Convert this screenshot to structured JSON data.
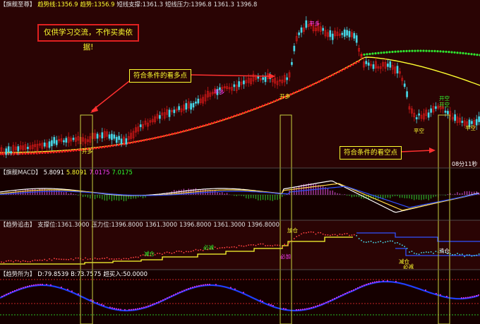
{
  "colors": {
    "bg_main": "#2a0404",
    "bg_sub": "#150000",
    "price_up": "#d01818",
    "price_down": "#46d6e6",
    "support": "#ffff30",
    "trend_red": "#ff2020",
    "trend_green": "#30e830",
    "macd_dif": "#ffffff",
    "macd_dea": "#ffd84a",
    "highlight": "#c8d040"
  },
  "pane1": {
    "title": "【旗舰至尊】",
    "trend1": "趋势线:1356.9",
    "trend2": "趋势:1356.9",
    "short_support": "短线支撑:1361.3",
    "short_resistance": "短线压力:1396.8",
    "v1": "1361.3",
    "v2": "1396.8"
  },
  "pane2": {
    "title": "【旗舰MACD】",
    "values": [
      "5.8091",
      "5.8091",
      "7.0175",
      "7.0175"
    ]
  },
  "pane3": {
    "title": "【趋势追击】",
    "support": "支撑位:1361.3000",
    "resistance": "压力位:1396.8000",
    "values": [
      "1361.3000",
      "1396.8000",
      "1361.3000",
      "1396.8000"
    ]
  },
  "pane4": {
    "title": "【趋势所为】",
    "d": "D:79.8539",
    "b": "B:73.7575",
    "buy": "超买入:50.0000"
  },
  "annotations": {
    "disclaimer": "仅供学习交流，不作买卖依据!",
    "bull_point": "符合条件的看多点",
    "bear_point": "符合条件的看空点",
    "timer": "08分11秒"
  },
  "signals": {
    "open_long_1": "开多",
    "open_long_2": "开多",
    "close_short_top": "平多",
    "close_short_mid": "平多",
    "open_short_1": "开空",
    "open_short_2": "开空",
    "close_short_1": "平空",
    "close_short_2": "平空",
    "reduce_1": "减仓",
    "reduce_2": "必减",
    "add_1": "加仓",
    "add_2": "必加",
    "clear_1": "清仓",
    "clear_2": "减仓",
    "clear_3": "必减"
  }
}
